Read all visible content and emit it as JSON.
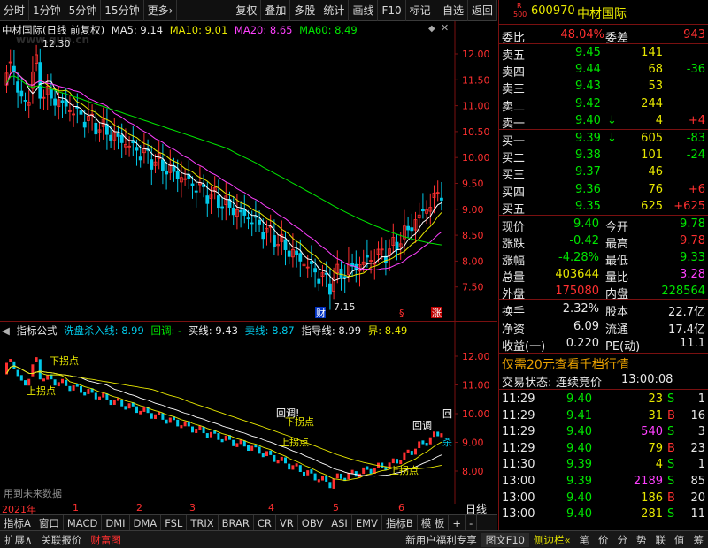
{
  "toolbar": {
    "items": [
      "分时",
      "1分钟",
      "5分钟",
      "15分钟",
      "更多›"
    ],
    "items_right": [
      "复权",
      "叠加",
      "多股",
      "统计",
      "画线",
      "F10",
      "标记",
      "-自选",
      "返回"
    ]
  },
  "main_chart": {
    "title": "中材国际(日线 前复权)",
    "ma5": "MA5: 9.14",
    "ma10": "MA10: 9.01",
    "ma20": "MA20: 8.65",
    "ma60": "MA60: 8.49",
    "high_label": "12.30",
    "low_label": "7.15",
    "marker_cai": "财",
    "marker_s": "§",
    "marker_zhang": "涨"
  },
  "indicator": {
    "title": "指标公式",
    "wash": "洗盘杀入线: 8.99",
    "huitiao": "回调: -",
    "buy": "买线: 9.43",
    "sell": "卖线: 8.87",
    "guide": "指导线: 8.99",
    "jie": "界: 8.49",
    "lbl_down": "下拐点",
    "lbl_up": "上拐点",
    "lbl_huitiao": "回调!",
    "lbl_down2": "下拐点",
    "lbl_up2": "上拐点",
    "lbl_huitiao2": "回调",
    "lbl_huitiao3": "回",
    "lbl_sha": "杀",
    "future_note": "用到未来数据"
  },
  "right_axis_main": [
    "12.00",
    "11.50",
    "11.00",
    "10.50",
    "10.00",
    "9.50",
    "9.00",
    "8.50",
    "8.00",
    "7.50"
  ],
  "right_axis_ind": [
    "12.00",
    "11.00",
    "10.00",
    "9.00",
    "8.00"
  ],
  "time_axis": [
    "2021年",
    "1",
    "2",
    "3",
    "4",
    "5",
    "6"
  ],
  "period_label": "日线",
  "bottom_tabs": [
    "指标A",
    "窗口",
    "MACD",
    "DMI",
    "DMA",
    "FSL",
    "TRIX",
    "BRAR",
    "CR",
    "VR",
    "OBV",
    "ASI",
    "EMV",
    "指标B",
    "模 板",
    "+",
    "-"
  ],
  "status": {
    "expand": "扩展∧",
    "link": "关联报价",
    "fortune": "财富图",
    "promo": "新用户福利专享",
    "f10": "图文F10",
    "sidebar": "侧边栏«",
    "icons": [
      "笔",
      "价",
      "分",
      "势",
      "联",
      "值",
      "筹"
    ]
  },
  "quote": {
    "r_label": "R",
    "code_prefix": "500",
    "code": "600970",
    "name": "中材国际",
    "weibi_label": "委比",
    "weibi": "48.04%",
    "weicha_label": "委差",
    "weicha": "943",
    "asks": [
      {
        "label": "卖五",
        "price": "9.45",
        "vol": "141",
        "chg": ""
      },
      {
        "label": "卖四",
        "price": "9.44",
        "vol": "68",
        "chg": "-36"
      },
      {
        "label": "卖三",
        "price": "9.43",
        "vol": "53",
        "chg": ""
      },
      {
        "label": "卖二",
        "price": "9.42",
        "vol": "244",
        "chg": ""
      },
      {
        "label": "卖一",
        "price": "9.40",
        "arrow": "↓",
        "vol": "4",
        "chg": "+4"
      }
    ],
    "bids": [
      {
        "label": "买一",
        "price": "9.39",
        "arrow": "↓",
        "vol": "605",
        "chg": "-83"
      },
      {
        "label": "买二",
        "price": "9.38",
        "vol": "101",
        "chg": "-24"
      },
      {
        "label": "买三",
        "price": "9.37",
        "vol": "46",
        "chg": ""
      },
      {
        "label": "买四",
        "price": "9.36",
        "vol": "76",
        "chg": "+6"
      },
      {
        "label": "买五",
        "price": "9.35",
        "vol": "625",
        "chg": "+625"
      }
    ],
    "stats": [
      {
        "l1": "现价",
        "v1": "9.40",
        "l2": "今开",
        "v2": "9.78"
      },
      {
        "l1": "涨跌",
        "v1": "-0.42",
        "l2": "最高",
        "v2": "9.78"
      },
      {
        "l1": "涨幅",
        "v1": "-4.28%",
        "l2": "最低",
        "v2": "9.33"
      },
      {
        "l1": "总量",
        "v1": "403644",
        "l2": "量比",
        "v2": "3.28"
      },
      {
        "l1": "外盘",
        "v1": "175080",
        "l2": "内盘",
        "v2": "228564"
      },
      {
        "l1": "换手",
        "v1": "2.32%",
        "l2": "股本",
        "v2": "22.7亿"
      },
      {
        "l1": "净资",
        "v1": "6.09",
        "l2": "流通",
        "v2": "17.4亿"
      },
      {
        "l1": "收益(一)",
        "v1": "0.220",
        "l2": "PE(动)",
        "v2": "11.1"
      }
    ],
    "ad": "仅需20元查看千档行情",
    "trade_status_label": "交易状态:",
    "trade_status": "连续竞价",
    "trade_time": "13:00:08",
    "ticks": [
      [
        "11:29",
        "9.40",
        "23",
        "S",
        "1"
      ],
      [
        "11:29",
        "9.41",
        "31",
        "B",
        "16"
      ],
      [
        "11:29",
        "9.40",
        "540",
        "S",
        "3"
      ],
      [
        "11:29",
        "9.40",
        "79",
        "B",
        "23"
      ],
      [
        "11:30",
        "9.39",
        "4",
        "S",
        "1"
      ],
      [
        "13:00",
        "9.39",
        "2189",
        "S",
        "85"
      ],
      [
        "13:00",
        "9.40",
        "186",
        "B",
        "20"
      ],
      [
        "13:00",
        "9.40",
        "281",
        "S",
        "11"
      ]
    ]
  },
  "colors": {
    "up": "#ff3030",
    "down": "#00e600",
    "ma5": "#ffffff",
    "ma10": "#e8e800",
    "ma20": "#ff40ff",
    "ma60": "#00e600",
    "bg": "#000000",
    "grid": "#7a1010"
  }
}
